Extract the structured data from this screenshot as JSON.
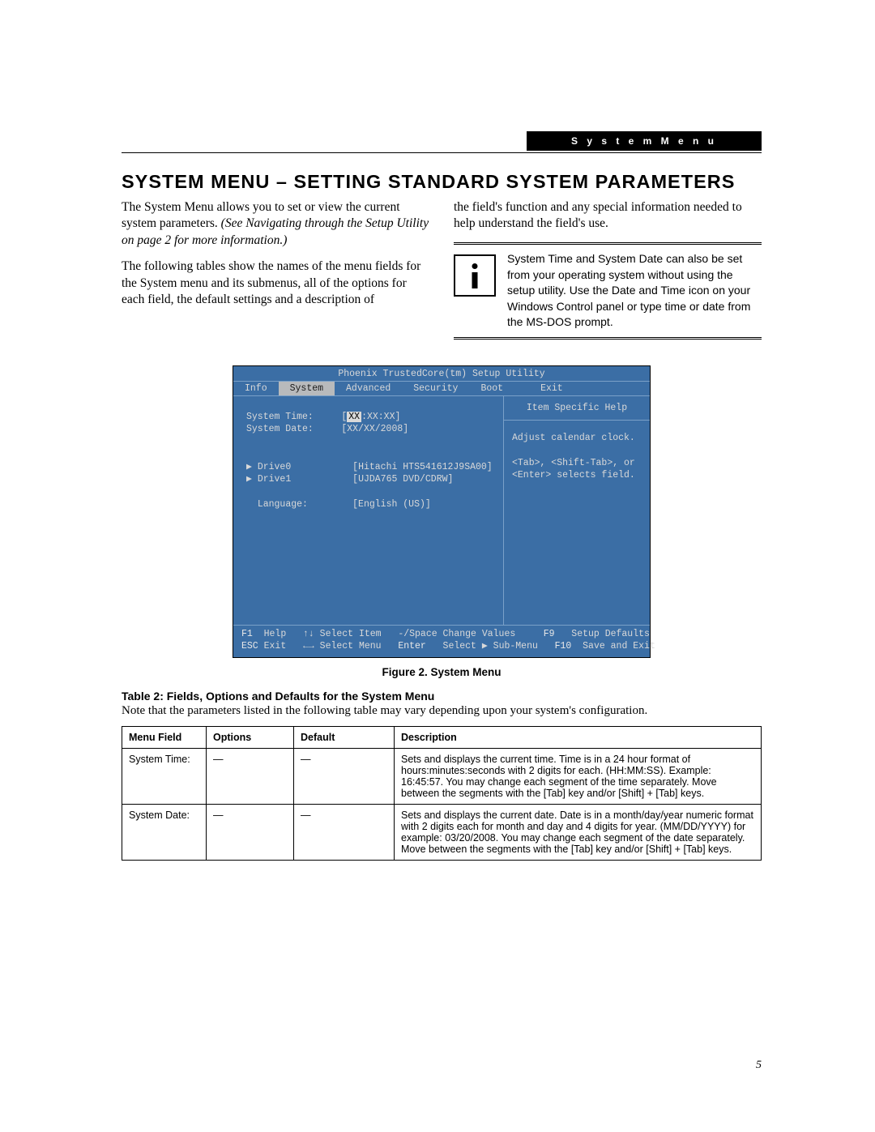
{
  "header_label": "S y s t e m   M e n u",
  "heading": "SYSTEM MENU – SETTING STANDARD SYSTEM PARAMETERS",
  "intro1": "The System Menu allows you to set or view the current system parameters. ",
  "intro1_italic": "(See Navigating through the Setup Utility on page 2 for more information.)",
  "intro2": "The following tables show the names of the menu fields for the System menu and its submenus, all of the options for each field, the default settings and a description of",
  "intro_right": "the field's function and any special information needed to help understand the field's use.",
  "note_text": "System Time and System Date can also be set from your operating system without using the setup utility. Use the Date and Time icon on your Windows Control panel or type time or date from the MS-DOS prompt.",
  "bios": {
    "title": "Phoenix TrustedCore(tm) Setup Utility",
    "tabs": [
      "Info",
      "System",
      "Advanced",
      "Security",
      "Boot",
      "Exit"
    ],
    "selected_tab": 1,
    "left_rows": {
      "time_label": "System Time:",
      "time_value_pre": "[",
      "time_value_hl": "XX",
      "time_value_post": ":XX:XX]",
      "date_label": "System Date:",
      "date_value": "[XX/XX/2008]",
      "drive0_label": "Drive0",
      "drive0_value": "[Hitachi HTS541612J9SA00]",
      "drive1_label": "Drive1",
      "drive1_value": "[UJDA765 DVD/CDRW]",
      "lang_label": "Language:",
      "lang_value": "[English (US)]"
    },
    "help_title": "Item Specific Help",
    "help_body1": "Adjust calendar clock.",
    "help_body2": "<Tab>, <Shift-Tab>, or",
    "help_body3": "<Enter> selects field.",
    "footer": {
      "f1": "F1",
      "help": "Help",
      "si": "Select Item",
      "cv": "Change Values",
      "f9": "F9",
      "sd": "Setup Defaults",
      "esc": "ESC",
      "exit": "Exit",
      "sm": "Select Menu",
      "enter": "Enter",
      "sub": "Select ▶ Sub-Menu",
      "f10": "F10",
      "se": "Save and Exit",
      "space_combo": "-/Space",
      "ud": "↑↓",
      "lr": "←→"
    }
  },
  "figure_caption": "Figure 2.  System Menu",
  "table_title": "Table 2: Fields, Options and Defaults for the System Menu",
  "table_note": "Note that the parameters listed in the following table may vary depending upon your system's configuration.",
  "table": {
    "headers": [
      "Menu Field",
      "Options",
      "Default",
      "Description"
    ],
    "rows": [
      {
        "field": "System Time:",
        "options": "—",
        "default": "—",
        "desc": "Sets and displays the current time. Time is in a 24 hour format of hours:minutes:seconds with 2 digits for each. (HH:MM:SS). Example: 16:45:57. You may change each segment of the time separately. Move between the segments with the [Tab] key and/or [Shift] + [Tab] keys."
      },
      {
        "field": "System Date:",
        "options": "—",
        "default": "—",
        "desc": "Sets and displays the current date. Date is in a month/day/year numeric format with 2 digits each for month and day and 4 digits for year. (MM/DD/YYYY) for example: 03/20/2008. You may change each segment of the date separately. Move between the segments with the [Tab] key and/or [Shift] + [Tab] keys."
      }
    ]
  },
  "page_number": "5"
}
